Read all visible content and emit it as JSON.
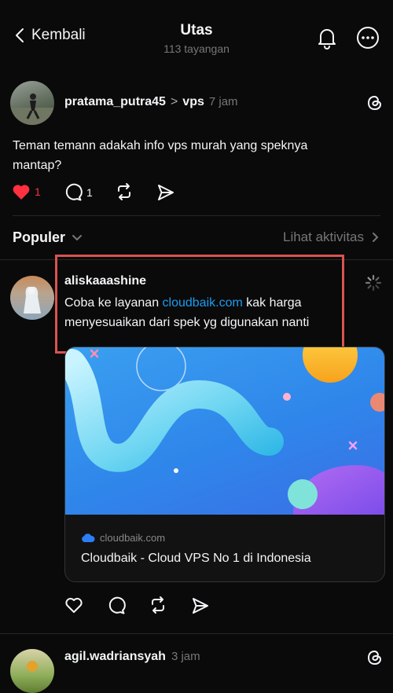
{
  "header": {
    "back_label": "Kembali",
    "title": "Utas",
    "views": "113 tayangan"
  },
  "post": {
    "username": "pratama_putra45",
    "topic_sep": ">",
    "topic": "vps",
    "time": "7 jam",
    "text": "Teman temann adakah info vps murah yang speknya mantap?",
    "likes": "1",
    "comments": "1"
  },
  "filter": {
    "label": "Populer",
    "activity": "Lihat aktivitas"
  },
  "reply": {
    "username": "aliskaaashine",
    "text_before": "Coba ke layanan ",
    "link": "cloudbaik.com",
    "text_after": " kak harga menyesuaikan dari spek yg digunakan nanti",
    "card": {
      "domain": "cloudbaik.com",
      "title": "Cloudbaik - Cloud VPS No 1 di Indonesia"
    }
  },
  "next_reply": {
    "username": "agil.wadriansyah",
    "time": "3 jam"
  },
  "colors": {
    "background": "#0a0a0a",
    "like": "#ff3040",
    "link": "#1d9bf0",
    "highlight": "#d9534f"
  }
}
